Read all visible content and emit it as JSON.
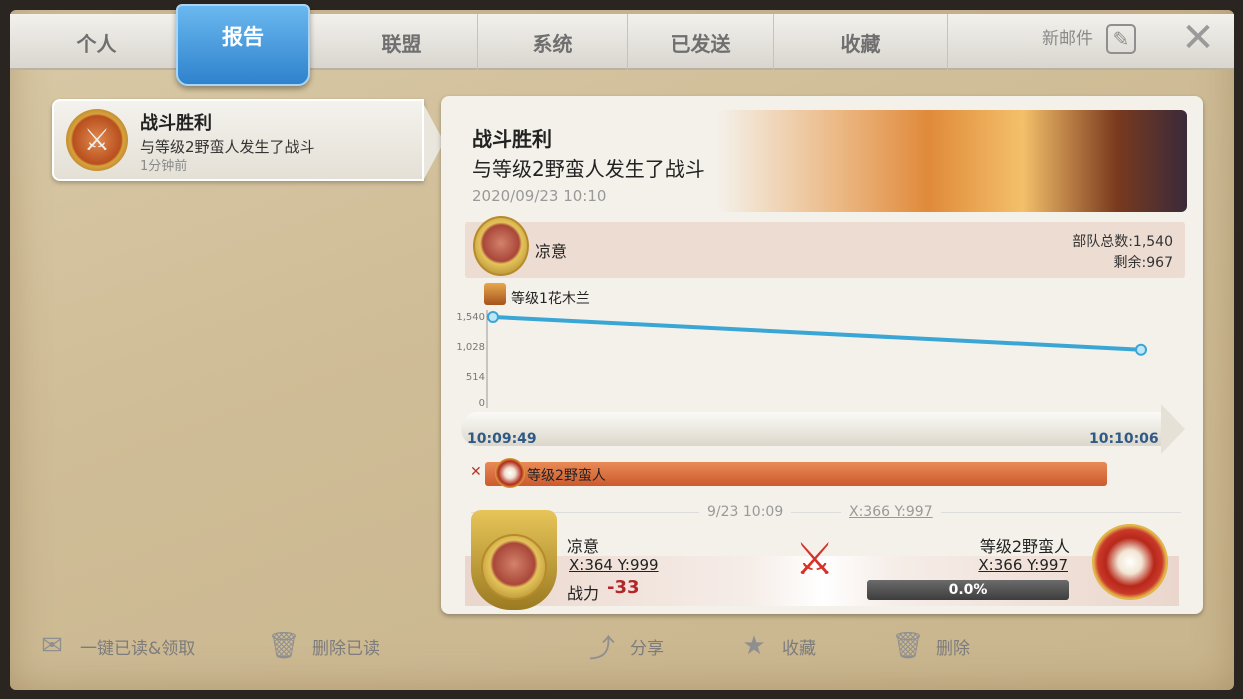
{
  "tabs": [
    {
      "label": "个人",
      "active": false
    },
    {
      "label": "报告",
      "active": true
    },
    {
      "label": "联盟",
      "active": false
    },
    {
      "label": "系统",
      "active": false
    },
    {
      "label": "已发送",
      "active": false
    },
    {
      "label": "收藏",
      "active": false
    }
  ],
  "header": {
    "new_mail_label": "新邮件",
    "new_mail_icon": "compose-icon",
    "close_icon": "close-icon"
  },
  "mail_list": {
    "items": [
      {
        "icon": "crossed-swords-badge-icon",
        "title": "战斗胜利",
        "subtitle": "与等级2野蛮人发生了战斗",
        "time": "1分钟前",
        "selected": true
      }
    ]
  },
  "report": {
    "title": "战斗胜利",
    "subtitle": "与等级2野蛮人发生了战斗",
    "date": "2020/09/23 10:10",
    "player": {
      "name": "凉意",
      "troops_total": "部队总数:1,540",
      "remaining": "剩余:967"
    },
    "commander_label": "等级1花木兰",
    "enemy_label": "等级2野蛮人",
    "timeline": {
      "start": "10:09:49",
      "end": "10:10:06"
    },
    "battle": {
      "time": "9/23 10:09",
      "coord": "X:366 Y:997",
      "attacker_name": "凉意",
      "attacker_coord": "X:364 Y:999",
      "power_label": "战力",
      "power_value": "-33",
      "defender_name": "等级2野蛮人",
      "defender_coord": "X:366 Y:997",
      "defender_progress": "0.0%"
    }
  },
  "chart_data": {
    "type": "line",
    "x": [
      "10:09:49",
      "10:10:06"
    ],
    "series": [
      {
        "values": [
          1540,
          967
        ],
        "color": "#3aa6d6"
      }
    ],
    "yticks": [
      "1,540",
      "1,028",
      "514",
      "0"
    ],
    "ylim": [
      0,
      1540
    ],
    "grid": false
  },
  "actions": {
    "read_all": "一键已读&领取",
    "delete_read": "删除已读",
    "share": "分享",
    "favorite": "收藏",
    "delete": "删除"
  },
  "colors": {
    "active_tab": "#2f82cc",
    "line": "#3aa6d6",
    "enemy_bar": "#cc5a2d",
    "power_negative": "#b3262a"
  }
}
